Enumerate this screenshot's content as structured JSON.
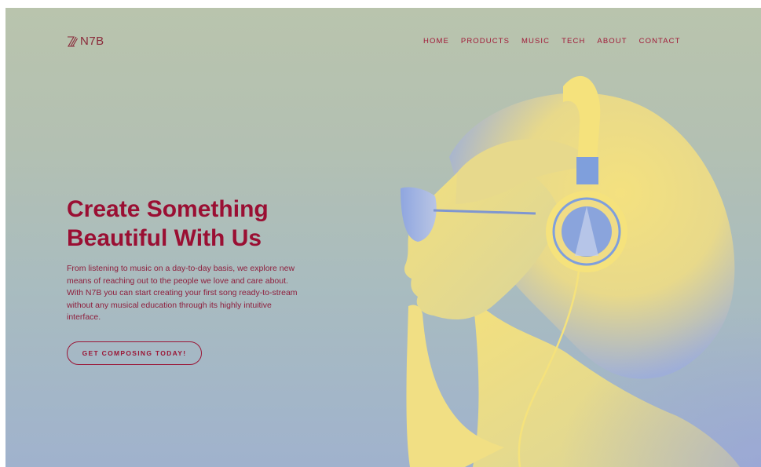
{
  "header": {
    "logo_text": "N7B",
    "nav": [
      "HOME",
      "PRODUCTS",
      "MUSIC",
      "TECH",
      "ABOUT",
      "CONTACT"
    ]
  },
  "hero": {
    "title_line1": "Create Something",
    "title_line2": "Beautiful With Us",
    "description": "From listening to music on a day-to-day basis, we explore new means of reaching out to the people we love and care about. With N7B you can start creating your first song ready-to-stream without any musical education through its highly intuitive interface.",
    "cta_label": "GET COMPOSING TODAY!"
  },
  "colors": {
    "accent": "#9a0f33",
    "background_top": "#b9c4ad",
    "background_bottom": "#a0b2cd",
    "photo_highlight": "#f3e07e",
    "photo_shadow": "#7f9fdc"
  },
  "icons": {
    "logo": "n7b-slash-logo-icon"
  }
}
